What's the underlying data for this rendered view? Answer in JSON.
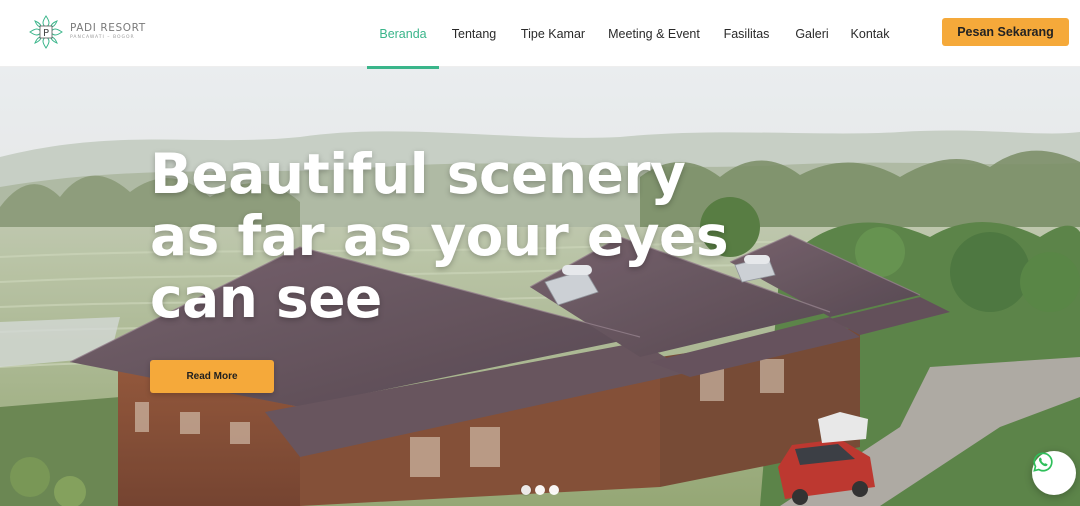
{
  "brand": {
    "name": "PADI RESORT",
    "tagline": "PANCAWATI – BOGOR",
    "monogram": "P",
    "accent": "#3ab58a",
    "cta_color": "#f5a93a"
  },
  "nav": {
    "items": [
      {
        "label": "Beranda",
        "active": true
      },
      {
        "label": "Tentang",
        "active": false
      },
      {
        "label": "Tipe Kamar",
        "active": false
      },
      {
        "label": "Meeting & Event",
        "active": false
      },
      {
        "label": "Fasilitas",
        "active": false
      },
      {
        "label": "Galeri",
        "active": false
      },
      {
        "label": "Kontak",
        "active": false
      }
    ],
    "cta_label": "Pesan Sekarang"
  },
  "hero": {
    "headline_lines": [
      "Beautiful scenery",
      "as far as your eyes",
      "can see"
    ],
    "button_label": "Read More",
    "slides": 3,
    "active_slide": 1
  },
  "floating": {
    "icon": "whatsapp-icon"
  }
}
